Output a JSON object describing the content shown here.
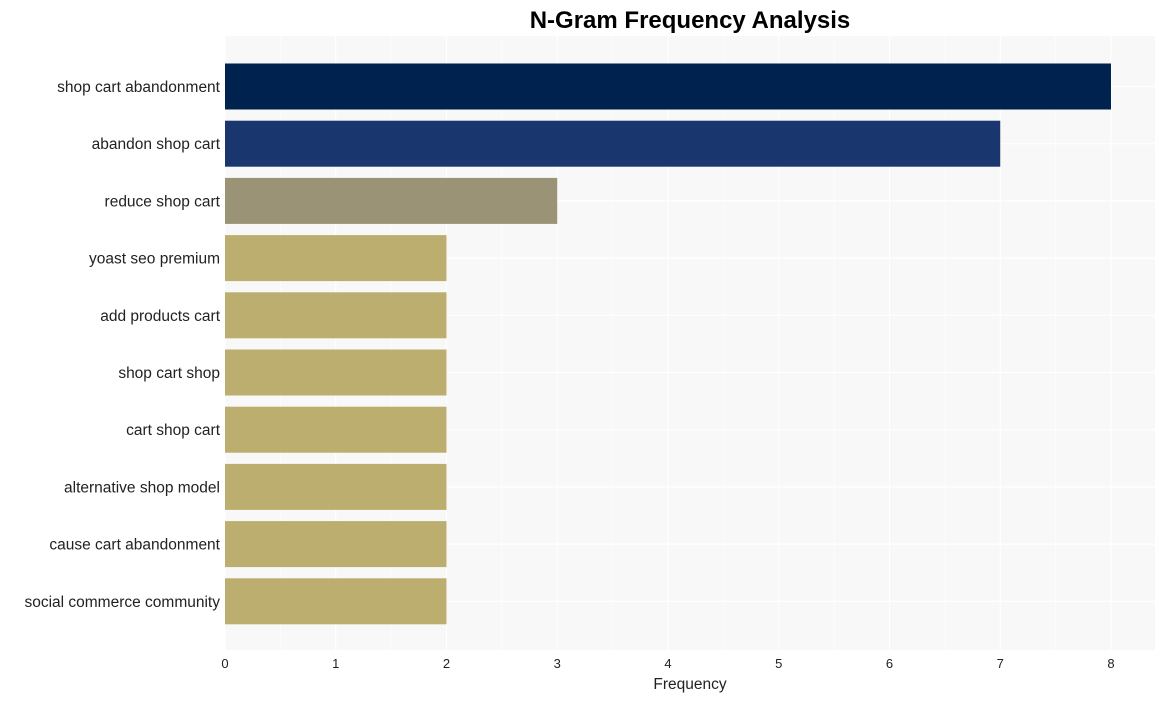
{
  "chart_data": {
    "type": "bar",
    "orientation": "horizontal",
    "title": "N-Gram Frequency Analysis",
    "xlabel": "Frequency",
    "ylabel": "",
    "xlim": [
      0,
      8.4
    ],
    "xticks": [
      0,
      1,
      2,
      3,
      4,
      5,
      6,
      7,
      8
    ],
    "grid": true,
    "legend": "none",
    "categories": [
      "shop cart abandonment",
      "abandon shop cart",
      "reduce shop cart",
      "yoast seo premium",
      "add products cart",
      "shop cart shop",
      "cart shop cart",
      "alternative shop model",
      "cause cart abandonment",
      "social commerce community"
    ],
    "values": [
      8,
      7,
      3,
      2,
      2,
      2,
      2,
      2,
      2,
      2
    ],
    "colors": [
      "#00224e",
      "#19366e",
      "#9a9375",
      "#bcae6e",
      "#bcae6e",
      "#bcae6e",
      "#bcae6e",
      "#bcae6e",
      "#bcae6e",
      "#bcae6e"
    ],
    "plot_background": "#f8f8f8",
    "grid_color": "#ffffff"
  }
}
